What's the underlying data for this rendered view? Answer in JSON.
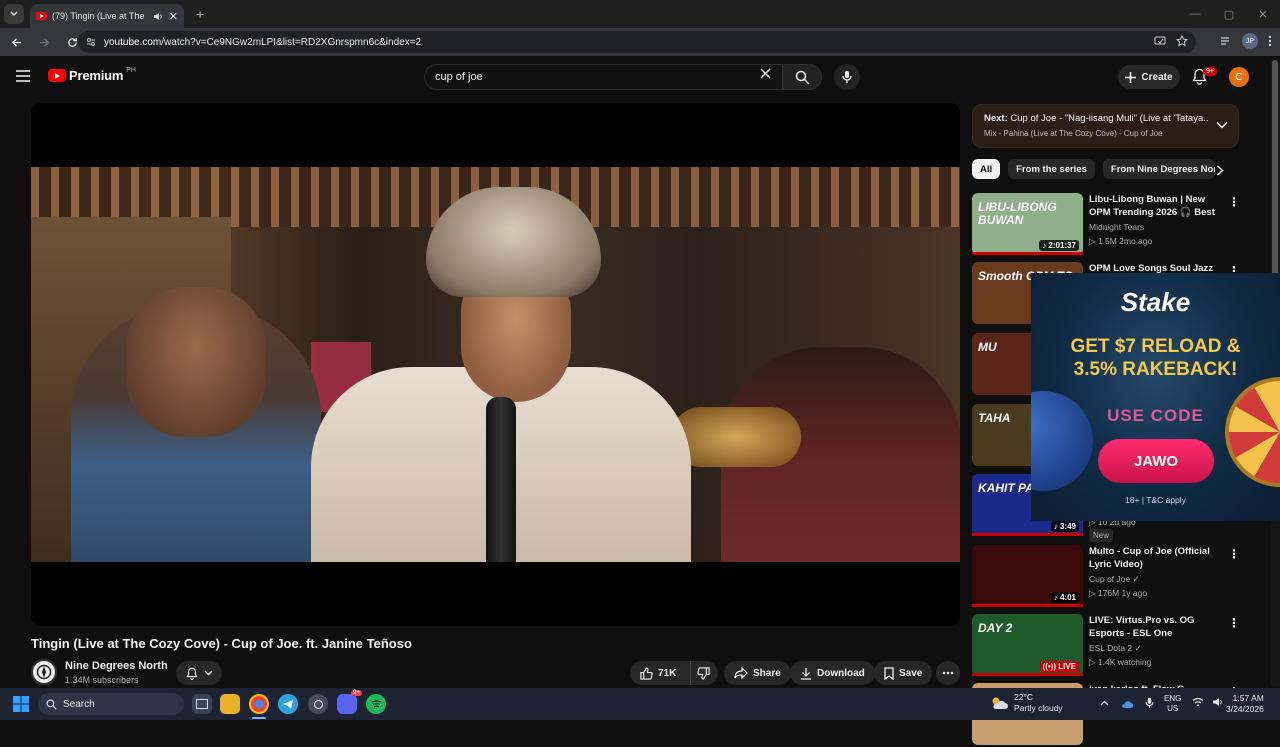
{
  "browser": {
    "tab_title": "(79) Tingin (Live at The Cozy Co...",
    "url_host": "youtube.com",
    "url_path": "/watch?v=Ce9NGw2mLPI&list=RD2XGnrspmn6c&index=2",
    "profile_initials": "JP"
  },
  "yt_header": {
    "logo_text": "Premium",
    "country_code": "PH",
    "search_query": "cup of joe",
    "create_label": "Create",
    "notification_count": "9+",
    "avatar_letter": "C"
  },
  "video": {
    "title": "Tingin (Live at The Cozy Cove) - Cup of Joe. ft. Janine Teñoso",
    "channel_name": "Nine Degrees North",
    "channel_subs": "1.34M subscribers",
    "likes": "71K",
    "share_label": "Share",
    "download_label": "Download",
    "save_label": "Save"
  },
  "playlist": {
    "next_prefix": "Next:",
    "next_title": "Cup of Joe - \"Nag-iisang Muli\" (Live at 'Tataya...",
    "subtitle": "Mix - Pahina (Live at The Cozy Cove) - Cup of Joe"
  },
  "chips": [
    "All",
    "From the series",
    "From Nine Degrees North"
  ],
  "recommendations": [
    {
      "title": "Libu-Libong Buwan | New OPM Trending 2026 🎧 Best Tagalo...",
      "channel": "Midnight Tears",
      "meta": "▷ 1.5M  2mo ago",
      "duration": "♪ 2:01:37",
      "thumb_color": "#8fae8a",
      "thumb_text": "LIBU-LIBONG BUWAN"
    },
    {
      "title": "OPM Love Songs Soul Jazz 💕",
      "channel": "",
      "meta": "",
      "duration": "",
      "thumb_color": "#6a3a1e",
      "thumb_text": "Smooth OPM TO"
    },
    {
      "title": "",
      "channel": "",
      "meta": "",
      "duration": "",
      "thumb_color": "#5a2418",
      "thumb_text": "MU"
    },
    {
      "title": "",
      "channel": "",
      "meta": "",
      "duration": "",
      "thumb_color": "#4a3a1e",
      "thumb_text": "TAHA"
    },
    {
      "title": "",
      "channel": "",
      "meta": "▷ 10  2d ago",
      "duration": "♪ 3:49",
      "thumb_color": "#1a2a8a",
      "thumb_text": "KAHIT PA"
    },
    {
      "title": "Multo - Cup of Joe (Official Lyric Video)",
      "channel": "Cup of Joe ✓",
      "meta": "▷ 176M  1y ago",
      "duration": "♪ 4:01",
      "thumb_color": "#3a0a0a",
      "thumb_text": ""
    },
    {
      "title": "LIVE: Virtus.Pro vs. OG Esports - ESL One Birmingham 2026",
      "channel": "ESL Dota 2 ✓",
      "meta": "▷ 1.4K watching",
      "duration": "",
      "live_label": "((•)) LIVE",
      "thumb_color": "#1e5a2a",
      "thumb_text": "DAY 2"
    },
    {
      "title": "ivan karlos ft. Flow G - Kailan...",
      "channel": "",
      "meta": "",
      "duration": "",
      "thumb_color": "#c8a070",
      "thumb_text": ""
    }
  ],
  "new_badge": "New",
  "ad": {
    "brand": "Stake",
    "headline_line1": "GET $7 RELOAD &",
    "headline_line2": "3.5% RAKEBACK!",
    "code_label": "USE CODE",
    "code": "JAWO",
    "terms": "18+ | T&C apply"
  },
  "taskbar": {
    "search_label": "Search",
    "weather_temp": "22°C",
    "weather_desc": "Partly cloudy",
    "lang_top": "ENG",
    "lang_bottom": "US",
    "time": "1:57 AM",
    "date": "3/24/2026",
    "discord_badge": "9+"
  },
  "colors": {
    "youtube_red": "#ff0000",
    "background": "#0f0f0f",
    "pill_bg": "#272727"
  }
}
